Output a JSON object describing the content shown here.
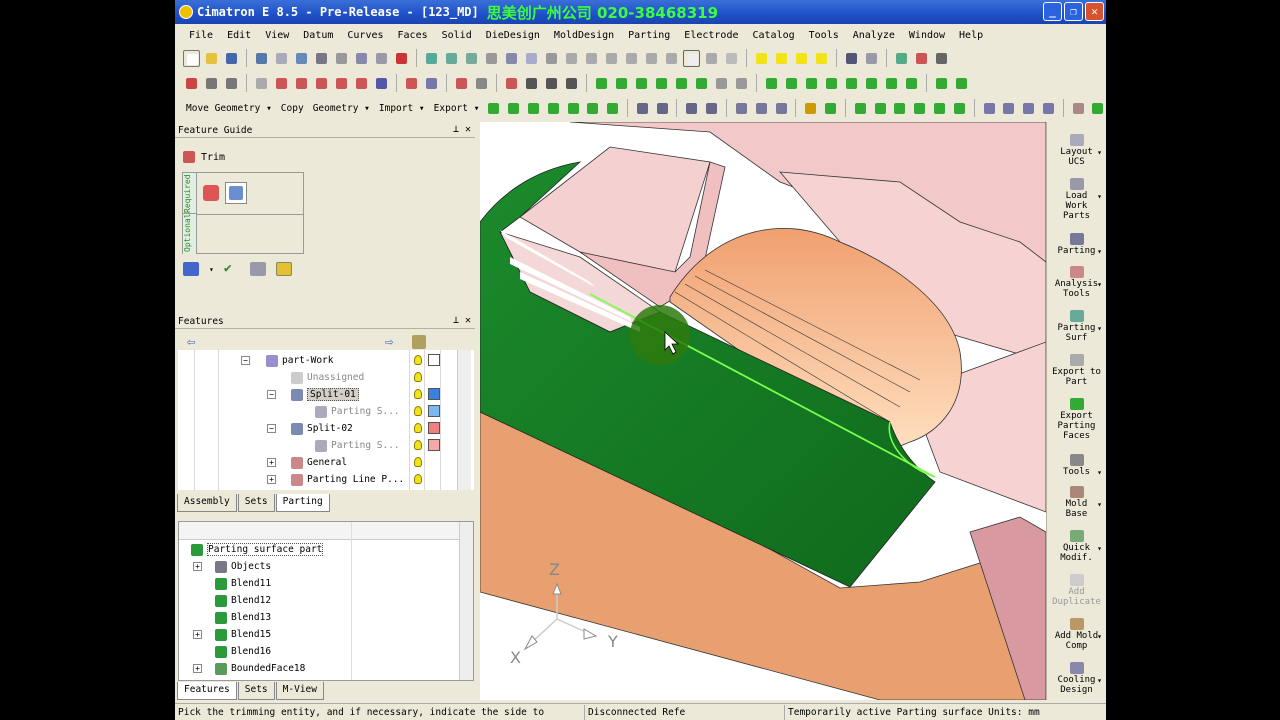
{
  "window": {
    "title": "Cimatron E 8.5 - Pre-Release - [123_MD]",
    "brand": "思美创广州公司 020-38468319",
    "min": "_",
    "max": "❐",
    "close": "✕"
  },
  "menu": [
    "File",
    "Edit",
    "View",
    "Datum",
    "Curves",
    "Faces",
    "Solid",
    "DieDesign",
    "MoldDesign",
    "Parting",
    "Electrode",
    "Catalog",
    "Tools",
    "Analyze",
    "Window",
    "Help"
  ],
  "toolbar3": {
    "move_geometry": "Move Geometry ▾",
    "copy": "Copy",
    "geometry": "Geometry ▾",
    "import": "Import ▾",
    "export": "Export ▾"
  },
  "feature_guide": {
    "title": "Feature Guide",
    "op": "Trim",
    "required": "Required",
    "optional": "Optional"
  },
  "features_panel": {
    "title": "Features",
    "rows": [
      {
        "label": "part-Work",
        "exp": "−"
      },
      {
        "label": "Unassigned"
      },
      {
        "label": "Split-01",
        "exp": "−"
      },
      {
        "label": "Parting S..."
      },
      {
        "label": "Split-02",
        "exp": "−"
      },
      {
        "label": "Parting S..."
      },
      {
        "label": "General",
        "exp": "+"
      },
      {
        "label": "Parting Line P...",
        "exp": "+"
      }
    ],
    "tabs": [
      "Assembly",
      "Sets",
      "Parting"
    ],
    "active_tab": "Parting"
  },
  "parting_tree": {
    "rows": [
      {
        "label": "Parting surface part"
      },
      {
        "label": "Objects",
        "exp": "+"
      },
      {
        "label": "Blend11"
      },
      {
        "label": "Blend12"
      },
      {
        "label": "Blend13"
      },
      {
        "label": "Blend15",
        "exp": "+"
      },
      {
        "label": "Blend16"
      },
      {
        "label": "BoundedFace18",
        "exp": "+"
      }
    ],
    "tabs": [
      "Features",
      "Sets",
      "M-View"
    ],
    "active_tab": "Features"
  },
  "axes": {
    "x": "X",
    "y": "Y",
    "z": "Z"
  },
  "right_toolbar": [
    {
      "label": "Layout\nUCS",
      "arrow": true
    },
    {
      "label": "Load\nWork\nParts",
      "arrow": true
    },
    {
      "label": "Parting",
      "arrow": true
    },
    {
      "label": "Analysis\nTools",
      "arrow": true
    },
    {
      "label": "Parting\nSurf",
      "arrow": true
    },
    {
      "label": "Export to\nPart"
    },
    {
      "label": "Export\nParting\nFaces"
    },
    {
      "label": "Tools",
      "arrow": true
    },
    {
      "label": "Mold\nBase",
      "arrow": true
    },
    {
      "label": "Quick\nModif.",
      "arrow": true
    },
    {
      "label": "Add\nDuplicate",
      "disabled": true
    },
    {
      "label": "Add Mold\nComp",
      "arrow": true
    },
    {
      "label": "Cooling\nDesign",
      "arrow": true
    }
  ],
  "status": {
    "prompt": "Pick the trimming entity, and if necessary, indicate the side to",
    "refs": "Disconnected Refe",
    "mode": "Temporarily active  Parting surface Units: mm"
  },
  "colors": {
    "accent_green": "#1a8a2a",
    "face_pink": "#f2c8c8",
    "face_orange": "#e8a070"
  }
}
